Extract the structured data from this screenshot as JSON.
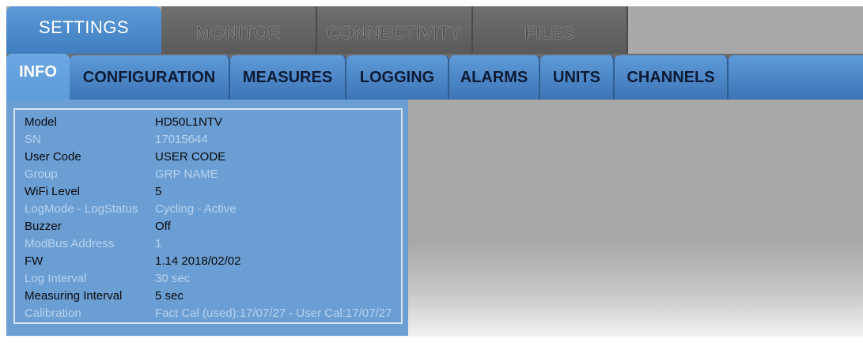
{
  "main_tabs": [
    {
      "label": "SETTINGS",
      "active": true
    },
    {
      "label": "MONITOR",
      "active": false
    },
    {
      "label": "CONNECTIVITY",
      "active": false
    },
    {
      "label": "FILES",
      "active": false
    }
  ],
  "sub_tabs": [
    {
      "label": "INFO",
      "active": true
    },
    {
      "label": "CONFIGURATION",
      "active": false
    },
    {
      "label": "MEASURES",
      "active": false
    },
    {
      "label": "LOGGING",
      "active": false
    },
    {
      "label": "ALARMS",
      "active": false
    },
    {
      "label": "UNITS",
      "active": false
    },
    {
      "label": "CHANNELS",
      "active": false
    }
  ],
  "info": [
    {
      "key": "Model",
      "value": "HD50L1NTV",
      "style": "bright"
    },
    {
      "key": "SN",
      "value": "17015644",
      "style": "dim"
    },
    {
      "key": "User Code",
      "value": "USER CODE",
      "style": "bright"
    },
    {
      "key": "Group",
      "value": "GRP NAME",
      "style": "dim"
    },
    {
      "key": "WiFi Level",
      "value": "5",
      "style": "bright"
    },
    {
      "key": "LogMode - LogStatus",
      "value": "Cycling - Active",
      "style": "dim"
    },
    {
      "key": "Buzzer",
      "value": "Off",
      "style": "bright"
    },
    {
      "key": "ModBus Address",
      "value": "1",
      "style": "dim"
    },
    {
      "key": "FW",
      "value": "1.14 2018/02/02",
      "style": "bright"
    },
    {
      "key": "Log Interval",
      "value": "30 sec",
      "style": "dim"
    },
    {
      "key": "Measuring Interval",
      "value": "5 sec",
      "style": "bright"
    },
    {
      "key": "Calibration",
      "value": "Fact Cal (used):17/07/27 - User Cal:17/07/27",
      "style": "dim"
    }
  ],
  "colors": {
    "active_blue": "#5c9bd9",
    "tab_blue": "#3d74b6",
    "dark_tab": "#5a5a5a",
    "content_gray": "#a8a8a8"
  }
}
